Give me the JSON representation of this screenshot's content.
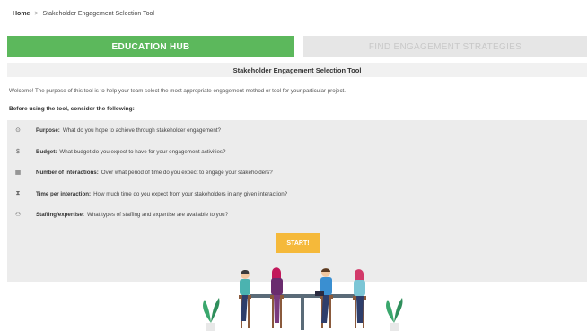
{
  "breadcrumb": {
    "home": "Home",
    "separator": ">",
    "current": "Stakeholder Engagement Selection Tool"
  },
  "tabs": [
    {
      "label": "EDUCATION HUB",
      "active": true
    },
    {
      "label": "FIND ENGAGEMENT STRATEGIES",
      "active": false
    }
  ],
  "panel": {
    "title": "Stakeholder Engagement Selection Tool",
    "welcome": "Welcome! The purpose of this tool is to help your team select the most appropriate engagement method or tool for your particular project.",
    "before": "Before using the tool, consider the following:"
  },
  "criteria": [
    {
      "icon": "target-icon",
      "glyph": "⊙",
      "label": "Purpose:",
      "text": "What do you hope to achieve through stakeholder engagement?"
    },
    {
      "icon": "dollar-icon",
      "glyph": "$",
      "label": "Budget:",
      "text": "What budget do you expect to have for your engagement activities?"
    },
    {
      "icon": "calendar-icon",
      "glyph": "▦",
      "label": "Number of interactions:",
      "text": "Over what period of time do you expect to engage your stakeholders?"
    },
    {
      "icon": "hourglass-icon",
      "glyph": "⧗",
      "label": "Time per interaction:",
      "text": "How much time do you expect from your stakeholders in any given interaction?"
    },
    {
      "icon": "person-icon",
      "glyph": "⚇",
      "label": "Staffing/expertise:",
      "text": "What types of staffing and expertise are available to you?"
    }
  ],
  "start_button": "START!",
  "colors": {
    "accent_green": "#5cb85c",
    "start_orange": "#f5b93a",
    "inactive_tab": "#e6e6e6"
  }
}
